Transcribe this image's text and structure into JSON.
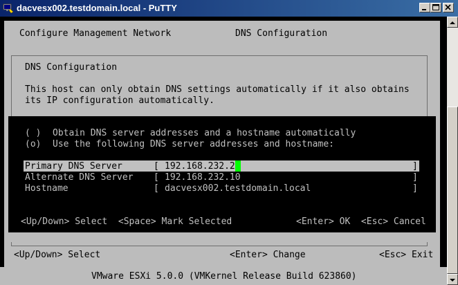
{
  "window": {
    "title": "dacvesx002.testdomain.local - PuTTY"
  },
  "icons": {
    "app": "putty-app-icon",
    "minimize": "minimize-icon",
    "maximize": "maximize-icon",
    "close": "close-icon",
    "scroll_up": "arrow-up-icon",
    "scroll_down": "arrow-down-icon"
  },
  "header": {
    "left": "Configure Management Network",
    "right": "DNS Configuration"
  },
  "dialog": {
    "title": "DNS Configuration",
    "description_line1": "This host can only obtain DNS settings automatically if it also obtains",
    "description_line2": "its IP configuration automatically.",
    "options": [
      {
        "marker": "( )",
        "label": "Obtain DNS server addresses and a hostname automatically"
      },
      {
        "marker": "(o)",
        "label": "Use the following DNS server addresses and hostname:"
      }
    ],
    "fields": [
      {
        "label": "Primary DNS Server",
        "value": "192.168.232.2"
      },
      {
        "label": "Alternate DNS Server",
        "value": "192.168.232.10"
      },
      {
        "label": "Hostname",
        "value": "dacvesx002.testdomain.local"
      }
    ],
    "field_open": "[",
    "field_close": "]",
    "keys_left": "<Up/Down> Select  <Space> Mark Selected",
    "keys_right": "<Enter> OK  <Esc> Cancel"
  },
  "footer": {
    "left": "<Up/Down> Select",
    "center": "<Enter> Change",
    "right": "<Esc> Exit"
  },
  "status_bar": "VMware ESXi 5.0.0 (VMKernel Release Build 623860)",
  "colors": {
    "title_bar_start": "#0a246a",
    "title_bar_end": "#3a6ea5",
    "panel_grey": "#bcbcbc",
    "terminal_black": "#000000",
    "cursor_green": "#00ff00",
    "terminal_text_light": "#c0c0c0"
  }
}
